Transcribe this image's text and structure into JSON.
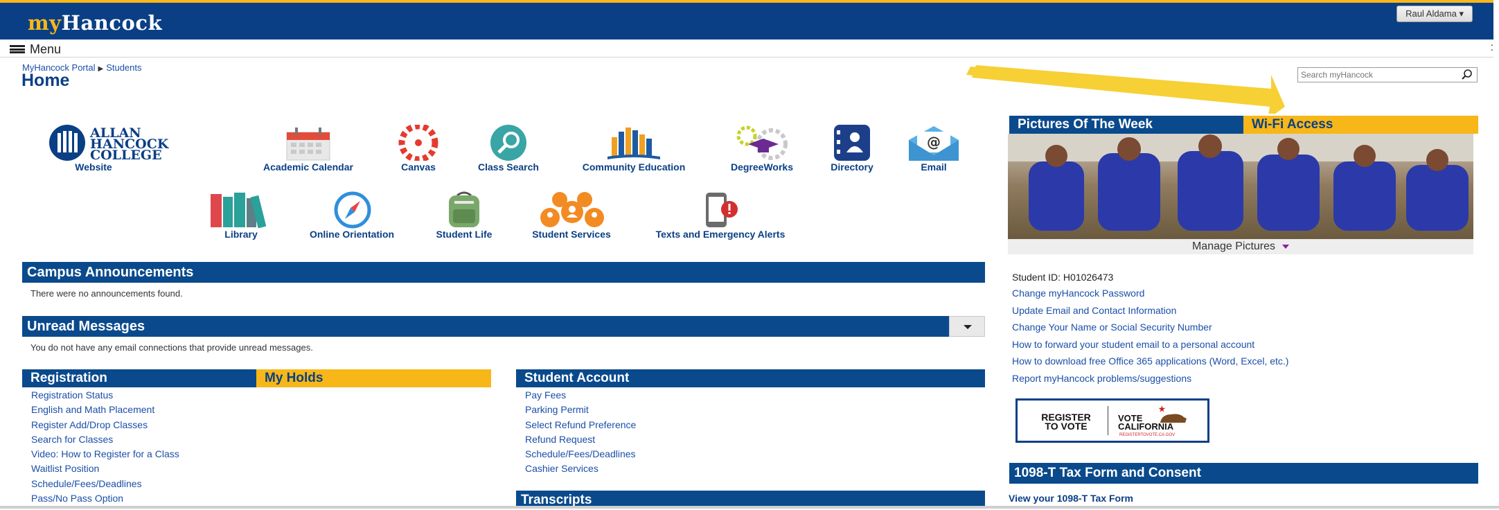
{
  "header": {
    "logo_prefix": "my",
    "logo_main": "Hancock",
    "user_name": "Raul Aldama ▾",
    "colors": {
      "brand_blue": "#0a3f85",
      "brand_gold": "#f7b718"
    }
  },
  "menubar": {
    "menu_label": "Menu",
    "right_glyph": ":"
  },
  "breadcrumb": {
    "root": "MyHancock Portal",
    "current": "Students"
  },
  "page": {
    "title": "Home"
  },
  "search": {
    "placeholder": "Search myHancock",
    "icon": "magnifier-icon"
  },
  "tiles_row1": [
    {
      "label": "Website",
      "icon": "allan-hancock-college-logo"
    },
    {
      "label": "Academic Calendar",
      "icon": "calendar-icon"
    },
    {
      "label": "Canvas",
      "icon": "canvas-icon"
    },
    {
      "label": "Class Search",
      "icon": "magnifier-icon"
    },
    {
      "label": "Community Education",
      "icon": "books-icon"
    },
    {
      "label": "DegreeWorks",
      "icon": "graduation-gear-icon"
    },
    {
      "label": "Directory",
      "icon": "address-book-icon"
    },
    {
      "label": "Email",
      "icon": "envelope-at-icon"
    }
  ],
  "logo_text": [
    "ALLAN",
    "HANCOCK",
    "COLLEGE"
  ],
  "tiles_row2": [
    {
      "label": "Library",
      "icon": "library-books-icon"
    },
    {
      "label": "Online Orientation",
      "icon": "compass-icon"
    },
    {
      "label": "Student Life",
      "icon": "backpack-icon"
    },
    {
      "label": "Student Services",
      "icon": "people-icon"
    },
    {
      "label": "Texts and Emergency Alerts",
      "icon": "phone-alert-icon"
    }
  ],
  "announcements": {
    "title": "Campus Announcements",
    "message": "There were no announcements found."
  },
  "unread": {
    "title": "Unread Messages",
    "message": "You do not have any email connections that provide unread messages."
  },
  "registration": {
    "tab_active": "Registration",
    "tab_other": "My Holds",
    "links": [
      "Registration Status",
      "English and Math Placement",
      "Register Add/Drop Classes",
      "Search for Classes",
      "Video: How to Register for a Class",
      "Waitlist Position",
      "Schedule/Fees/Deadlines",
      "Pass/No Pass Option"
    ]
  },
  "student_account": {
    "title": "Student Account",
    "links": [
      "Pay Fees",
      "Parking Permit",
      "Select Refund Preference",
      "Refund Request",
      "Schedule/Fees/Deadlines",
      "Cashier Services"
    ]
  },
  "transcripts": {
    "title": "Transcripts"
  },
  "pictures": {
    "tab_active": "Pictures Of The Week",
    "tab_other": "Wi-Fi Access",
    "manage": "Manage Pictures"
  },
  "student": {
    "id_label": "Student ID: H01026473",
    "links": [
      "Change myHancock Password",
      "Update Email and Contact Information",
      "Change Your Name or Social Security Number",
      "How to forward your student email to a personal account",
      "How to download free Office 365 applications (Word, Excel, etc.)",
      "Report myHancock problems/suggestions"
    ]
  },
  "vote": {
    "line1": "REGISTER",
    "line2": "TO VOTE",
    "line3": "VOTE",
    "line4": "CALIFORNIA",
    "url": "REGISTERTOVOTE.CA.GOV"
  },
  "tax": {
    "title": "1098-T Tax Form and Consent",
    "link": "View your 1098-T Tax Form"
  }
}
